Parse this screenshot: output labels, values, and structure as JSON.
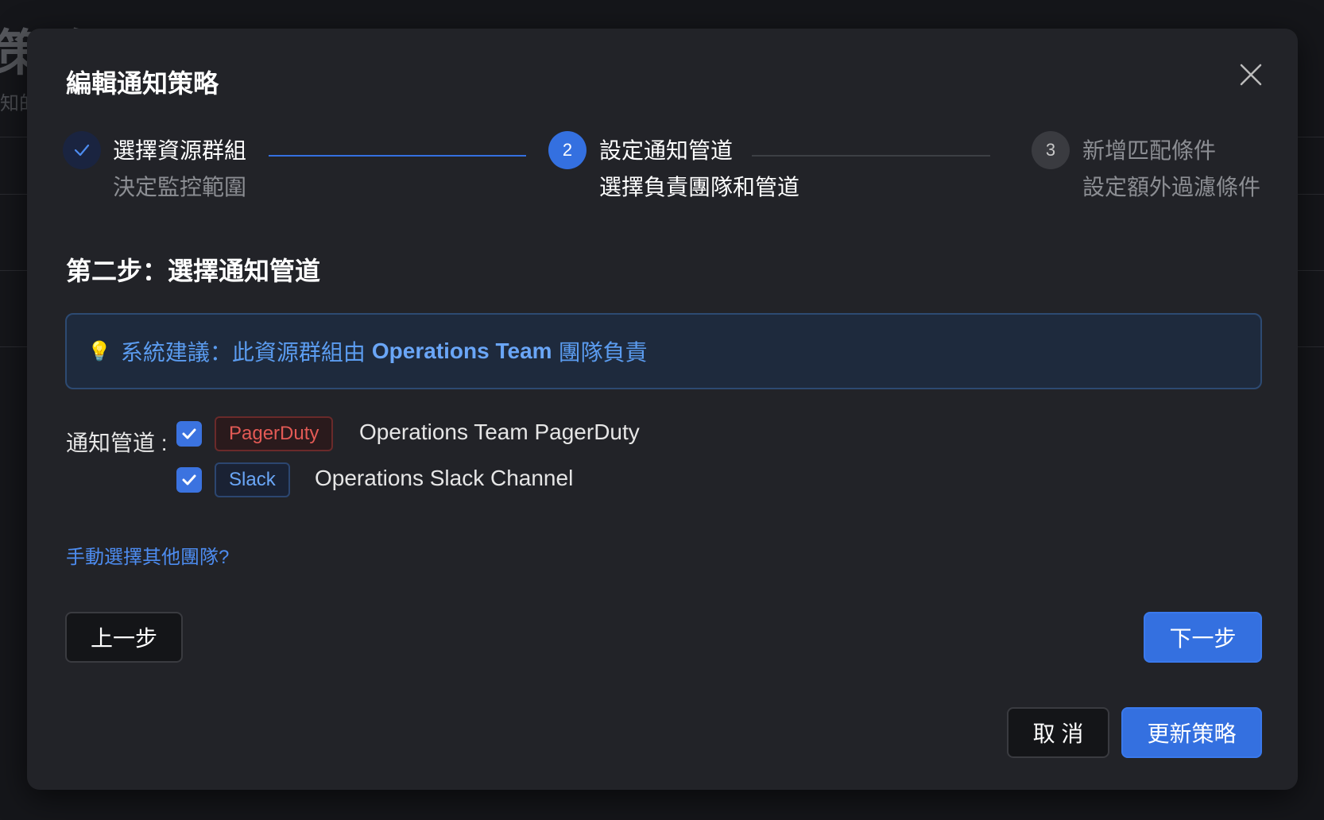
{
  "background": {
    "title": "策略",
    "subtitle": "知的"
  },
  "modal": {
    "title": "編輯通知策略"
  },
  "steps": [
    {
      "status": "done",
      "title": "選擇資源群組",
      "desc": "決定監控範圍"
    },
    {
      "status": "active",
      "number": "2",
      "title": "設定通知管道",
      "desc": "選擇負責團隊和管道"
    },
    {
      "status": "pending",
      "number": "3",
      "title": "新增匹配條件",
      "desc": "設定額外過濾條件"
    }
  ],
  "section": {
    "title": "第二步：選擇通知管道"
  },
  "tip": {
    "prefix": "系統建議：此資源群組由",
    "team": "Operations Team",
    "suffix": "團隊負責"
  },
  "channels": {
    "label": "通知管道 :",
    "items": [
      {
        "checked": true,
        "tag": "PagerDuty",
        "name": "Operations Team PagerDuty",
        "tag_color": "#e35a55"
      },
      {
        "checked": true,
        "tag": "Slack",
        "name": "Operations Slack Channel",
        "tag_color": "#6aa6f7"
      }
    ]
  },
  "manual_link": "手動選擇其他團隊?",
  "buttons": {
    "prev": "上一步",
    "next": "下一步",
    "cancel": "取 消",
    "update": "更新策略"
  },
  "colors": {
    "accent": "#3470e0",
    "modal_bg": "#222328"
  }
}
